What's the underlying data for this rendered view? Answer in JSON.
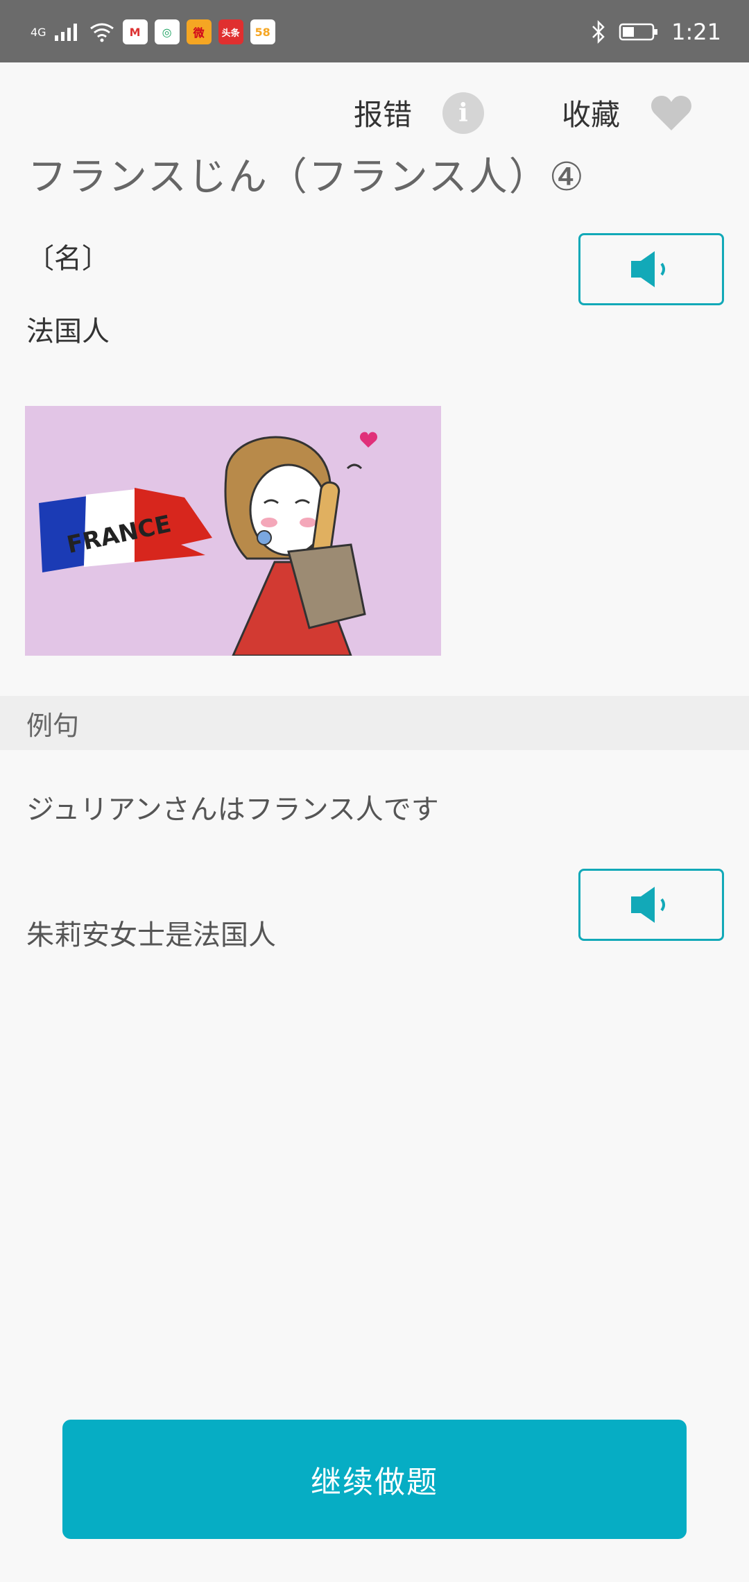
{
  "status_bar": {
    "network": "4G",
    "app_icons": [
      {
        "name": "gmail-icon",
        "label": "M",
        "color": "#ffffff"
      },
      {
        "name": "browser-icon",
        "label": "◎",
        "color": "#ffffff"
      },
      {
        "name": "weibo-icon",
        "label": "微",
        "color": "#f5a623"
      },
      {
        "name": "toutiao-icon",
        "label": "头条",
        "color": "#e02f2f"
      },
      {
        "name": "58-icon",
        "label": "58",
        "color": "#ffffff"
      }
    ],
    "time": "1:21"
  },
  "toolbar": {
    "report_label": "报错",
    "favorite_label": "收藏"
  },
  "word": {
    "title": "フランスじん（フランス人）④",
    "part_of_speech": "〔名〕",
    "meaning": "法国人",
    "image_text": "FRANCE"
  },
  "examples": {
    "header": "例句",
    "sentence_jp": "ジュリアンさんはフランス人です",
    "sentence_cn": "朱莉安女士是法国人"
  },
  "footer": {
    "continue_label": "继续做题"
  },
  "colors": {
    "accent": "#06adc4",
    "status_bar": "#6b6b6b",
    "image_background": "#e2c5e6"
  }
}
